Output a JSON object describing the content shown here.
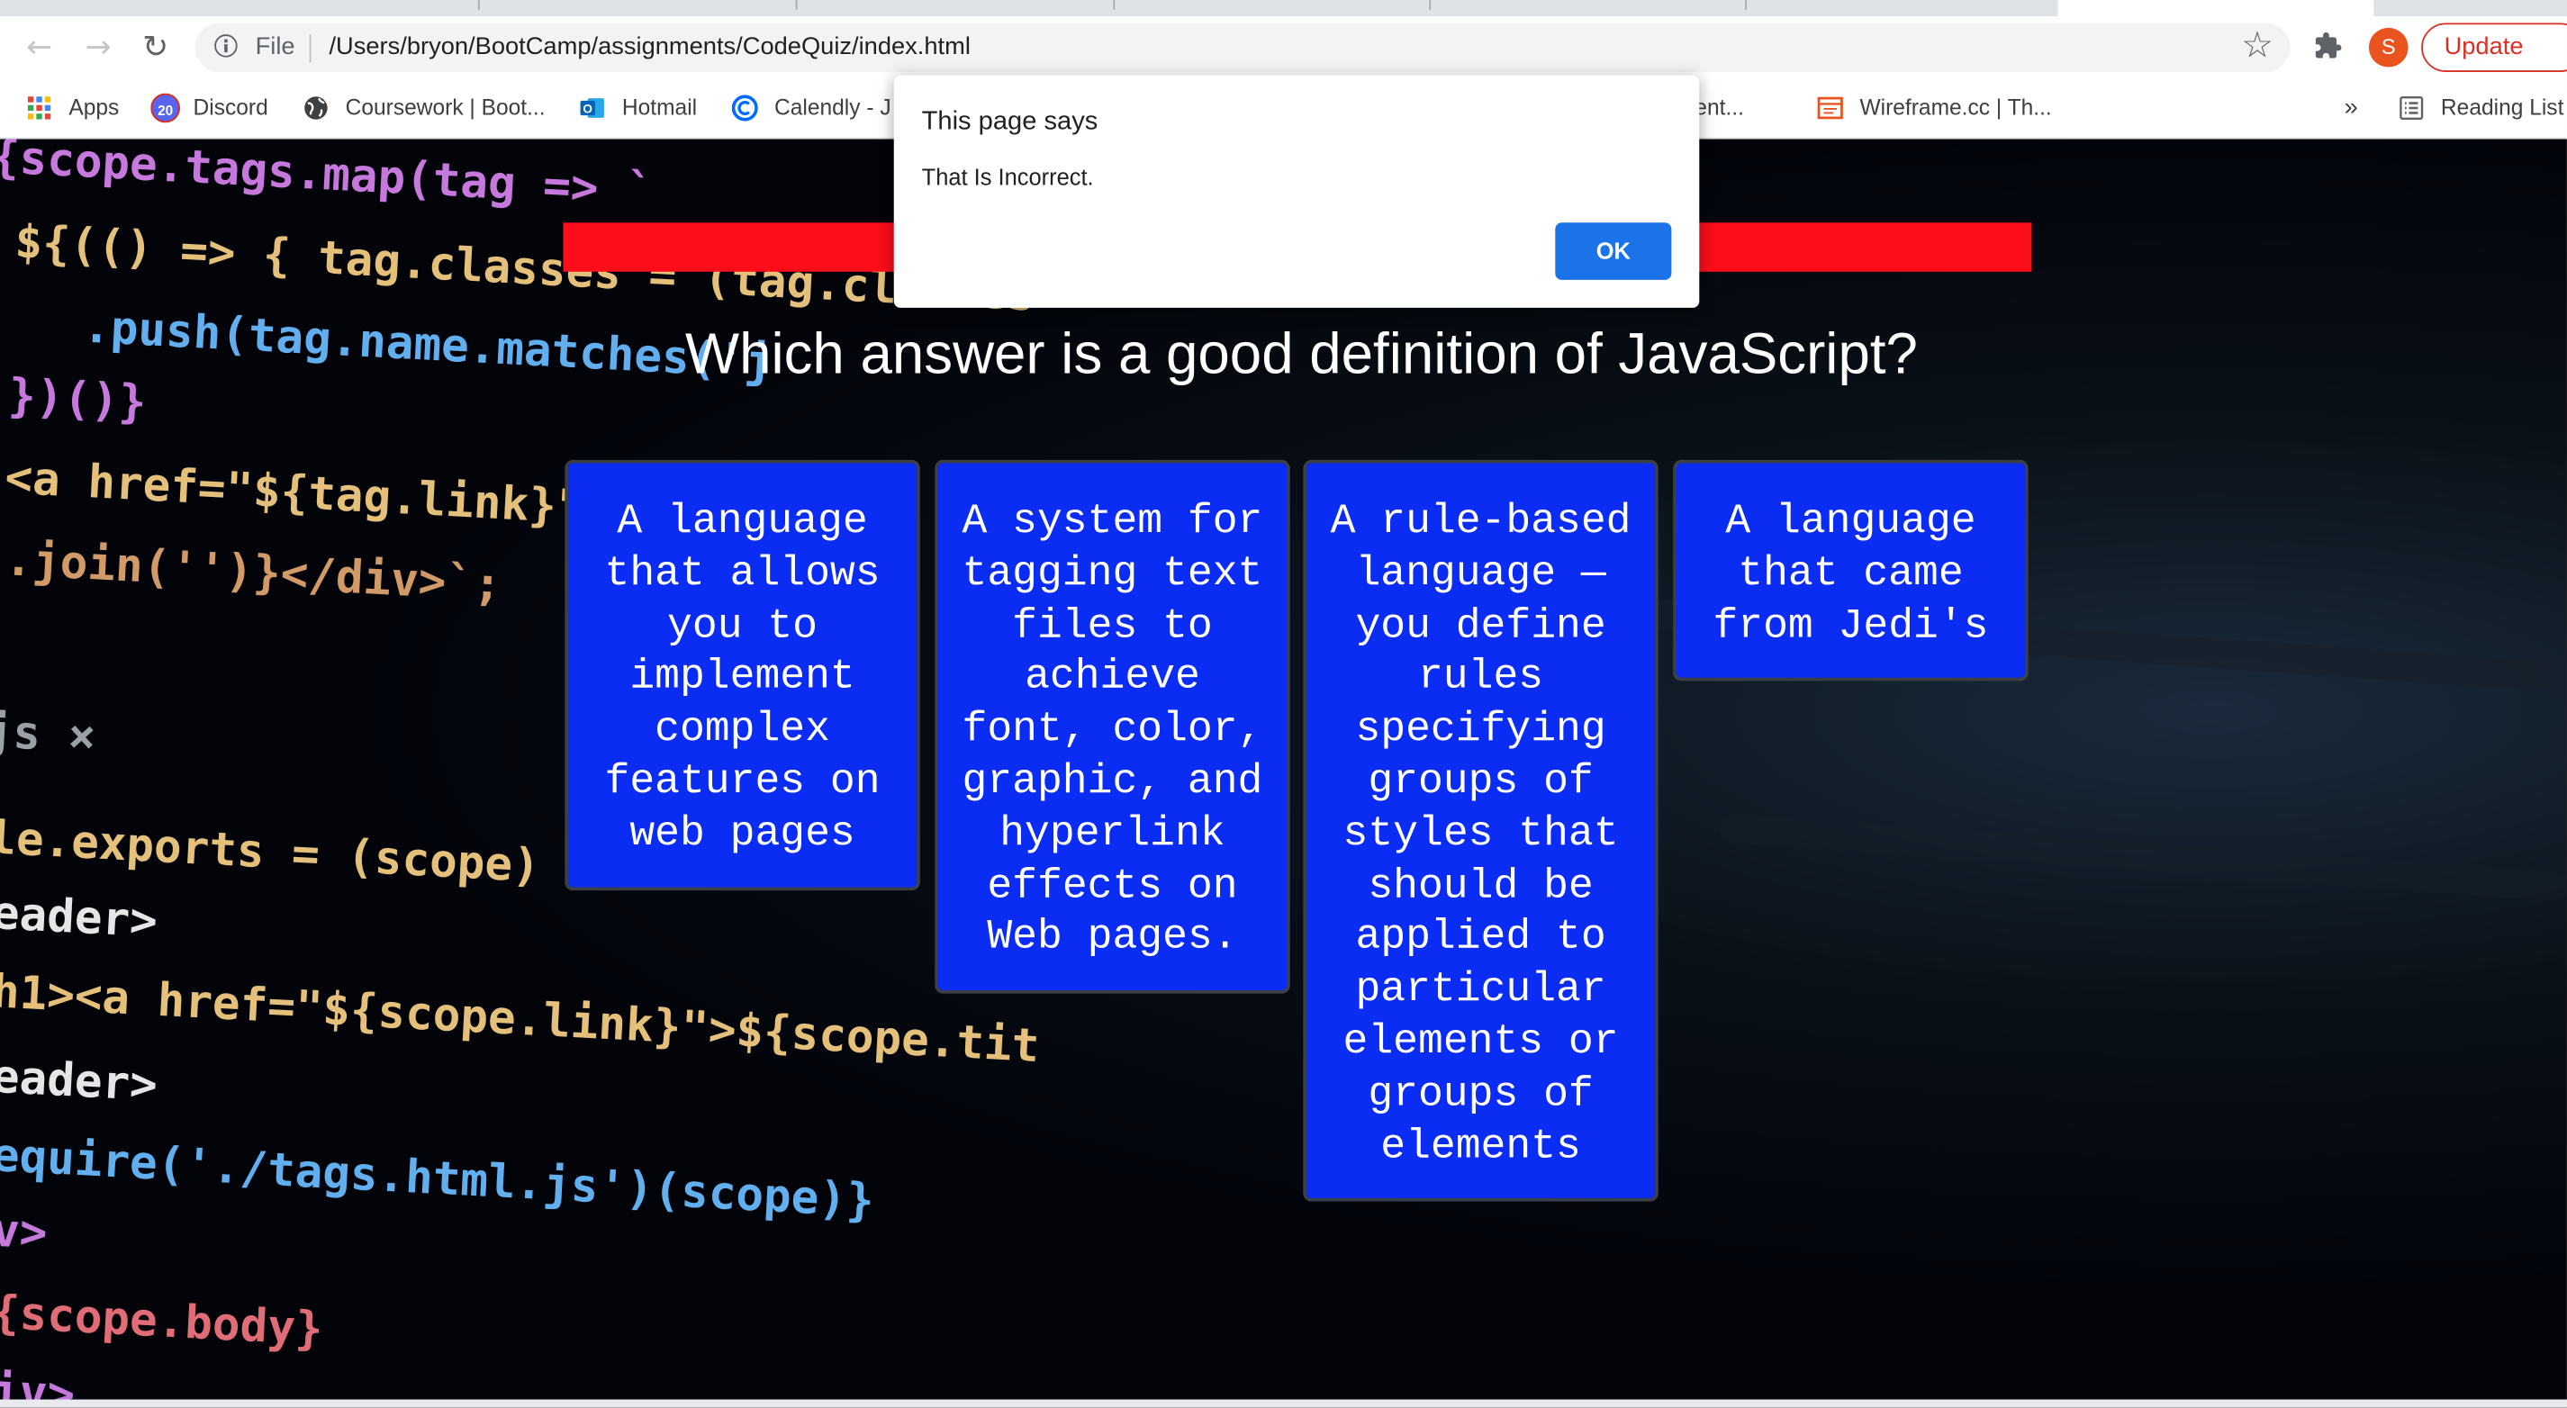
{
  "browser": {
    "url_scheme_label": "File",
    "url": "/Users/bryon/BootCamp/assignments/CodeQuiz/index.html",
    "profile_initial": "S",
    "update_label": "Update"
  },
  "bookmarks": {
    "items": [
      {
        "label": "Apps"
      },
      {
        "label": "Discord",
        "badge": "20"
      },
      {
        "label": "Coursework | Boot..."
      },
      {
        "label": "Hotmail"
      },
      {
        "label": "Calendly - J"
      },
      {
        "label": "t Event..."
      },
      {
        "label": "Wireframe.cc | Th..."
      }
    ],
    "overflow": "»",
    "reading_list": "Reading List"
  },
  "quiz": {
    "question": "Which answer is a good definition of JavaScript?",
    "answers": [
      "A language that allows you to implement complex features on web pages",
      "A system for tagging text files to achieve font, color, graphic, and hyperlink effects on Web pages.",
      "A rule-based language — you define rules specifying groups of styles that should be applied to particular elements or groups of elements",
      "A language that came from Jedi's"
    ]
  },
  "background_code": [
    "{scope.tags.map(tag => `",
    "${(() => { tag.classes = (tag.classes",
    "  .push(tag.name.matches('j",
    "})()}",
    "<a href=\"${tag.link}\" c",
    ".join('')}</div>`;",
    "js ×",
    "le.exports = (scope) =>",
    "eader>",
    "h1><a href=\"${scope.link}\">${scope.tit",
    "eader>",
    "equire('./tags.html.js')(scope)}",
    "v>",
    "{scope.body}",
    "iv>"
  ],
  "dialog": {
    "title": "This page says",
    "message": "That Is Incorrect.",
    "ok_label": "OK"
  },
  "colors": {
    "answer_bg": "#0b2cf2",
    "red_bar": "#fb0e1a",
    "ok_button": "#1a73e8",
    "update_red": "#d93025"
  }
}
